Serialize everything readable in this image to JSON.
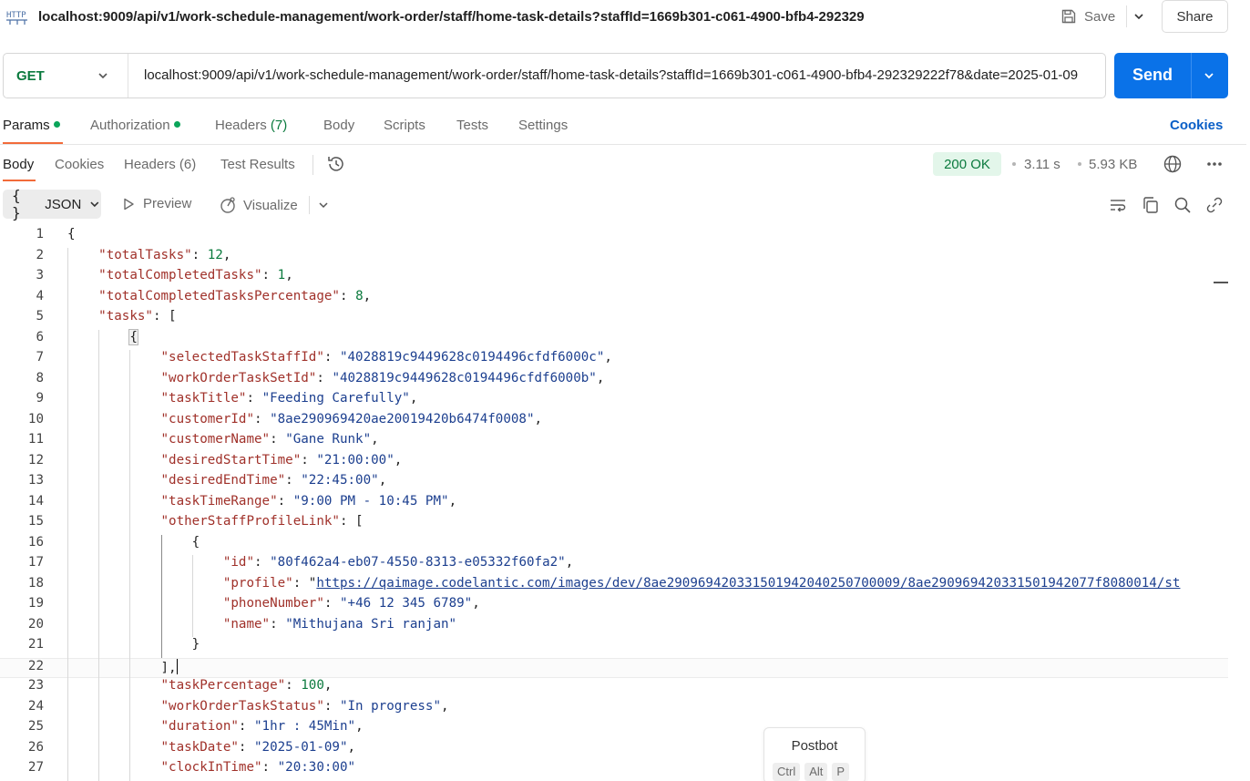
{
  "window": {
    "title": "localhost:9009/api/v1/work-schedule-management/work-order/staff/home-task-details?staffId=1669b301-c061-4900-bfb4-292329",
    "save_label": "Save",
    "share_label": "Share"
  },
  "request": {
    "method": "GET",
    "url": "localhost:9009/api/v1/work-schedule-management/work-order/staff/home-task-details?staffId=1669b301-c061-4900-bfb4-292329222f78&date=2025-01-09",
    "send_label": "Send"
  },
  "request_tabs": {
    "params": "Params",
    "authorization": "Authorization",
    "headers": "Headers",
    "headers_count": "(7)",
    "body": "Body",
    "scripts": "Scripts",
    "tests": "Tests",
    "settings": "Settings",
    "cookies": "Cookies"
  },
  "response_tabs": {
    "body": "Body",
    "cookies": "Cookies",
    "headers": "Headers (6)",
    "test_results": "Test Results"
  },
  "response_meta": {
    "status": "200 OK",
    "time": "3.11 s",
    "size": "5.93 KB",
    "status_color": "#0b7a3e"
  },
  "format_bar": {
    "format": "JSON",
    "preview": "Preview",
    "visualize": "Visualize"
  },
  "code": {
    "lines": [
      "{",
      "    \"totalTasks\": 12,",
      "    \"totalCompletedTasks\": 1,",
      "    \"totalCompletedTasksPercentage\": 8,",
      "    \"tasks\": [",
      "        {",
      "            \"selectedTaskStaffId\": \"4028819c9449628c0194496cfdf6000c\",",
      "            \"workOrderTaskSetId\": \"4028819c9449628c0194496cfdf6000b\",",
      "            \"taskTitle\": \"Feeding Carefully\",",
      "            \"customerId\": \"8ae290969420ae20019420b6474f0008\",",
      "            \"customerName\": \"Gane Runk\",",
      "            \"desiredStartTime\": \"21:00:00\",",
      "            \"desiredEndTime\": \"22:45:00\",",
      "            \"taskTimeRange\": \"9:00 PM - 10:45 PM\",",
      "            \"otherStaffProfileLink\": [",
      "                {",
      "                    \"id\": \"80f462a4-eb07-4550-8313-e05332f60fa2\",",
      "                    \"profile\": \"https://qaimage.codelantic.com/images/dev/8ae290969420331501942040250700009/8ae290969420331501942077f8080014/st",
      "                    \"phoneNumber\": \"+46 12 345 6789\",",
      "                    \"name\": \"Mithujana Sri ranjan\"",
      "                }",
      "            ],",
      "            \"taskPercentage\": 100,",
      "            \"workOrderTaskStatus\": \"In progress\",",
      "            \"duration\": \"1hr : 45Min\",",
      "            \"taskDate\": \"2025-01-09\",",
      "            \"clockInTime\": \"20:30:00\""
    ]
  },
  "postbot": {
    "title": "Postbot",
    "keys": [
      "Ctrl",
      "Alt",
      "P"
    ]
  }
}
